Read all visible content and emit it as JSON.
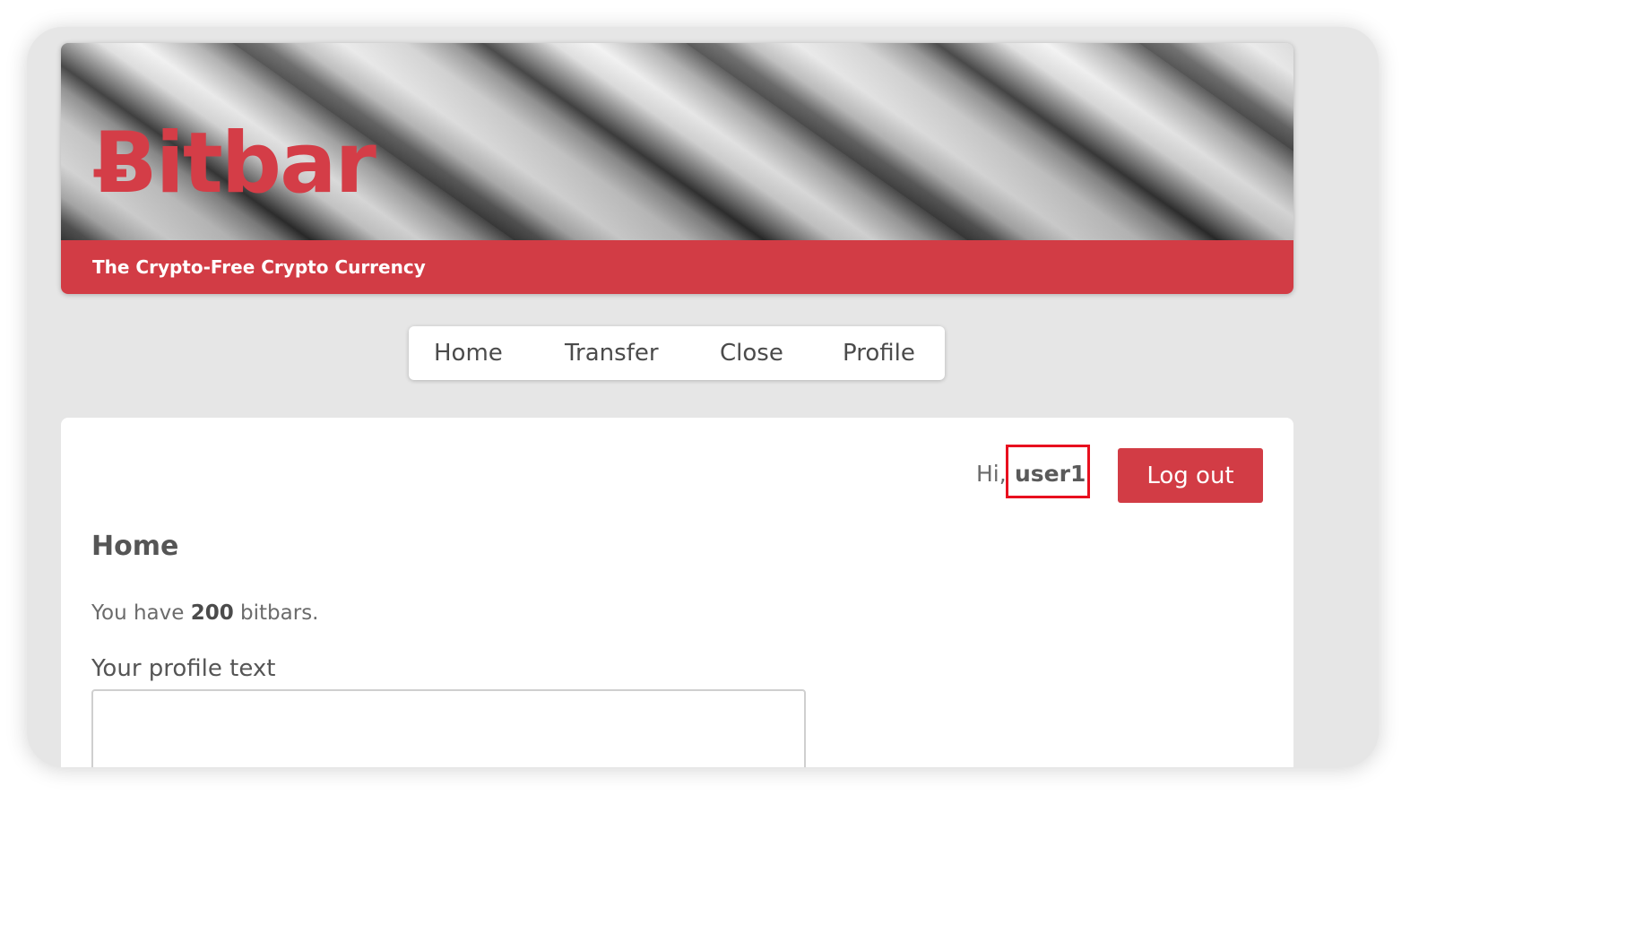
{
  "header": {
    "brand": "Ƀitbar",
    "tagline": "The Crypto-Free Crypto Currency"
  },
  "nav": {
    "items": [
      {
        "label": "Home"
      },
      {
        "label": "Transfer"
      },
      {
        "label": "Close"
      },
      {
        "label": "Profile"
      }
    ]
  },
  "user": {
    "greeting_prefix": "Hi,",
    "username": "user1",
    "logout_label": "Log out"
  },
  "main": {
    "title": "Home",
    "balance_prefix": "You have",
    "balance_amount": "200",
    "balance_suffix": "bitbars.",
    "profile_label": "Your profile text",
    "profile_value": ""
  },
  "colors": {
    "brand_red": "#d23c45",
    "highlight_red": "#e8101f",
    "background": "#e6e6e6"
  }
}
